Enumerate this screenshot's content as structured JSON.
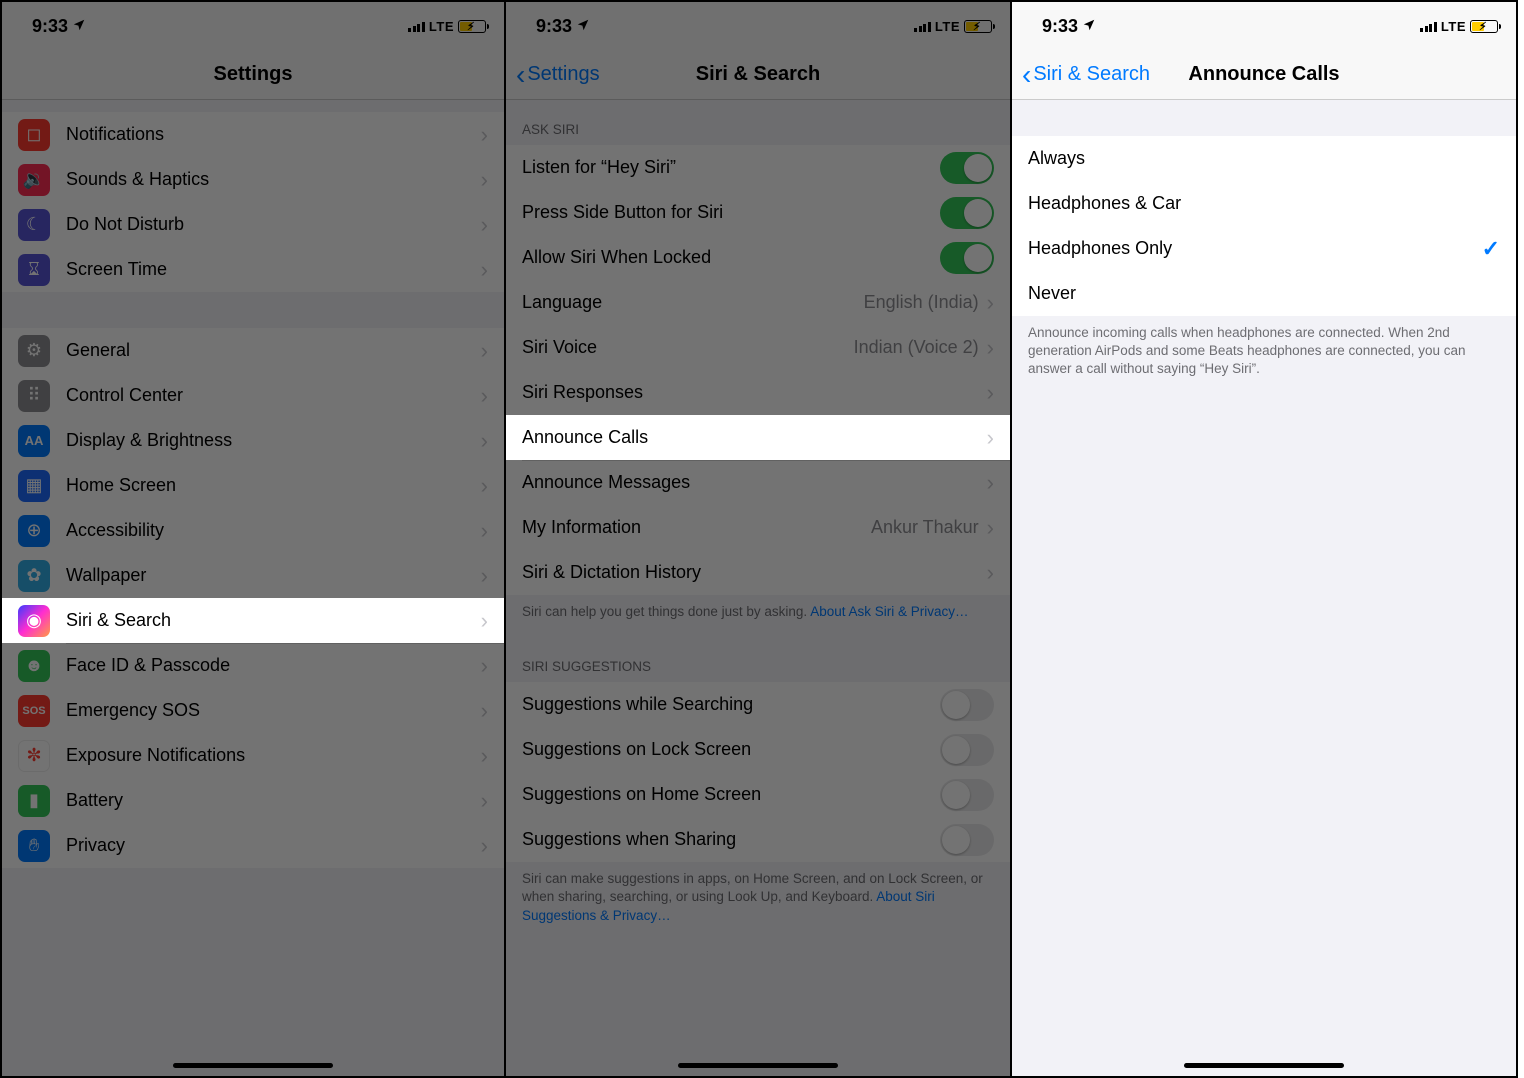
{
  "status": {
    "time": "9:33",
    "network": "LTE"
  },
  "screen1": {
    "title": "Settings",
    "items": [
      {
        "label": "Notifications"
      },
      {
        "label": "Sounds & Haptics"
      },
      {
        "label": "Do Not Disturb"
      },
      {
        "label": "Screen Time"
      },
      {
        "label": "General"
      },
      {
        "label": "Control Center"
      },
      {
        "label": "Display & Brightness"
      },
      {
        "label": "Home Screen"
      },
      {
        "label": "Accessibility"
      },
      {
        "label": "Wallpaper"
      },
      {
        "label": "Siri & Search"
      },
      {
        "label": "Face ID & Passcode"
      },
      {
        "label": "Emergency SOS"
      },
      {
        "label": "Exposure Notifications"
      },
      {
        "label": "Battery"
      },
      {
        "label": "Privacy"
      }
    ]
  },
  "screen2": {
    "back": "Settings",
    "title": "Siri & Search",
    "sectionAskSiri": "ASK SIRI",
    "rows": {
      "listen": "Listen for “Hey Siri”",
      "press": "Press Side Button for Siri",
      "locked": "Allow Siri When Locked",
      "language_label": "Language",
      "language_value": "English (India)",
      "voice_label": "Siri Voice",
      "voice_value": "Indian (Voice 2)",
      "responses": "Siri Responses",
      "announce_calls": "Announce Calls",
      "announce_msgs": "Announce Messages",
      "myinfo_label": "My Information",
      "myinfo_value": "Ankur Thakur",
      "history": "Siri & Dictation History"
    },
    "footer1_a": "Siri can help you get things done just by asking. ",
    "footer1_link": "About Ask Siri & Privacy…",
    "sectionSuggestions": "SIRI SUGGESTIONS",
    "sug": {
      "search": "Suggestions while Searching",
      "lock": "Suggestions on Lock Screen",
      "home": "Suggestions on Home Screen",
      "share": "Suggestions when Sharing"
    },
    "footer2_a": "Siri can make suggestions in apps, on Home Screen, and on Lock Screen, or when sharing, searching, or using Look Up, and Keyboard. ",
    "footer2_link": "About Siri Suggestions & Privacy…"
  },
  "screen3": {
    "back": "Siri & Search",
    "title": "Announce Calls",
    "options": [
      {
        "label": "Always",
        "selected": false
      },
      {
        "label": "Headphones & Car",
        "selected": false
      },
      {
        "label": "Headphones Only",
        "selected": true
      },
      {
        "label": "Never",
        "selected": false
      }
    ],
    "footer": "Announce incoming calls when headphones are connected. When 2nd generation AirPods and some Beats headphones are connected, you can answer a call without saying “Hey Siri”."
  }
}
